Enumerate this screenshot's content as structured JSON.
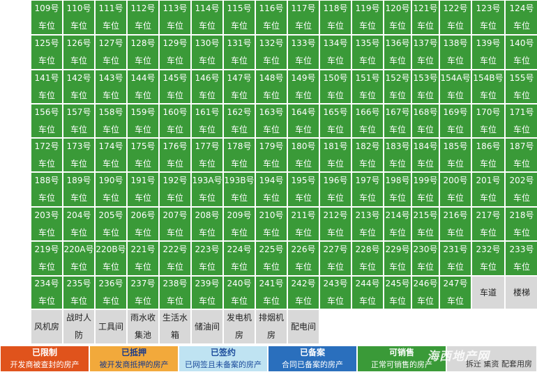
{
  "colors": {
    "sellable": "#3a9a38",
    "special": "#d8d8d8",
    "restricted": "#e0531c",
    "mortgaged": "#f2a93b",
    "signed": "#bfe3f2",
    "filed": "#2a6fbd",
    "not_for_sale": "#d8d8d8"
  },
  "rows": [
    [
      "109号车位",
      "110号车位",
      "111号车位",
      "112号车位",
      "113号车位",
      "114号车位",
      "115号车位",
      "116号车位",
      "117号车位",
      "118号车位",
      "119号车位",
      "120号\n车位",
      "121号\n车位",
      "122号车位",
      "123号车位",
      "124号车位"
    ],
    [
      "125号车位",
      "126号车位",
      "127号车位",
      "128号车位",
      "129号车位",
      "130号车位",
      "131号车位",
      "132号车位",
      "133号车位",
      "134号车位",
      "135号车位",
      "136号\n车位",
      "137号\n车位",
      "138号车位",
      "139号车位",
      "140号车位"
    ],
    [
      "141号车位",
      "142号车位",
      "143号车位",
      "144号车位",
      "145号车位",
      "146号车位",
      "147号车位",
      "148号车位",
      "149号车位",
      "150号车位",
      "151号车位",
      "152号\n车位",
      "153号\n车位",
      "154A号\n车位",
      "154B号\n车位",
      "155号车位"
    ],
    [
      "156号车位",
      "157号车位",
      "158号车位",
      "159号车位",
      "160号车位",
      "161号车位",
      "162号车位",
      "163号车位",
      "164号车位",
      "165号车位",
      "166号车位",
      "167号\n车位",
      "168号\n车位",
      "169号车位",
      "170号车位",
      "171号车位"
    ],
    [
      "172号车位",
      "173号车位",
      "174号车位",
      "175号车位",
      "176号车位",
      "177号车位",
      "178号车位",
      "179号车位",
      "180号车位",
      "181号车位",
      "182号车位",
      "183号\n车位",
      "184号\n车位",
      "185号车位",
      "186号车位",
      "187号车位"
    ],
    [
      "188号车位",
      "189号车位",
      "190号车位",
      "191号车位",
      "192号车位",
      "193A号\n车位",
      "193B号\n车位",
      "194号车位",
      "195号车位",
      "196号车位",
      "197号车位",
      "198号\n车位",
      "199号\n车位",
      "200号车位",
      "201号车位",
      "202号车位"
    ],
    [
      "203号车位",
      "204号车位",
      "205号车位",
      "206号车位",
      "207号车位",
      "208号车位",
      "209号车位",
      "210号车位",
      "211号车位",
      "212号车位",
      "213号车位",
      "214号\n车位",
      "215号\n车位",
      "216号车位",
      "217号车位",
      "218号车位"
    ],
    [
      "219号车位",
      "220A号\n车位",
      "220B号\n车位",
      "221号车位",
      "222号车位",
      "223号车位",
      "224号车位",
      "225号车位",
      "226号车位",
      "227号车位",
      "228号车位",
      "229号\n车位",
      "230号\n车位",
      "231号车位",
      "232号车位",
      "233号车位"
    ],
    [
      "234号车位",
      "235号车位",
      "236号车位",
      "237号车位",
      "238号车位",
      "239号车位",
      "240号车位",
      "241号车位",
      "242号车位",
      "243号车位",
      "244号车位",
      "245号\n车位",
      "246号\n车位",
      "247号车位",
      "车道",
      "楼梯"
    ],
    [
      "风机房",
      "战时人防",
      "工具间",
      "雨水收集池",
      "生活水箱",
      "储油间",
      "发电机房",
      "排烟机房",
      "配电间",
      "",
      "",
      "",
      "",
      "",
      "",
      ""
    ]
  ],
  "row_kinds": [
    "gggggggggggggggg",
    "gggggggggggggggg",
    "gggggggggggggggg",
    "gggggggggggggggg",
    "gggggggggggggggg",
    "gggggggggggggggg",
    "gggggggggggggggg",
    "gggggggggggggggg",
    "ggggggggggggggss",
    "ssssssssseeeeeee"
  ],
  "legend": [
    {
      "title": "已限制",
      "desc": "开发商被查封的房产",
      "color": "#e0531c",
      "text_color": "#ffffff"
    },
    {
      "title": "已抵押",
      "desc": "被开发商抵押的房产",
      "color": "#f2a93b",
      "text_color": "#1a3a8a"
    },
    {
      "title": "已签约",
      "desc": "已网签且未备案的房产",
      "color": "#bfe3f2",
      "text_color": "#1a4a9a"
    },
    {
      "title": "已备案",
      "desc": "合同已备案的房产",
      "color": "#2a6fbd",
      "text_color": "#ffffff"
    },
    {
      "title": "可销售",
      "desc": "正常可销售的房产",
      "color": "#3a9a38",
      "text_color": "#ffffff"
    },
    {
      "title": "",
      "desc": "拆迁 集资 配套用房",
      "color": "#d8d8d8",
      "text_color": "#333333"
    }
  ],
  "watermark": "海西地产网"
}
